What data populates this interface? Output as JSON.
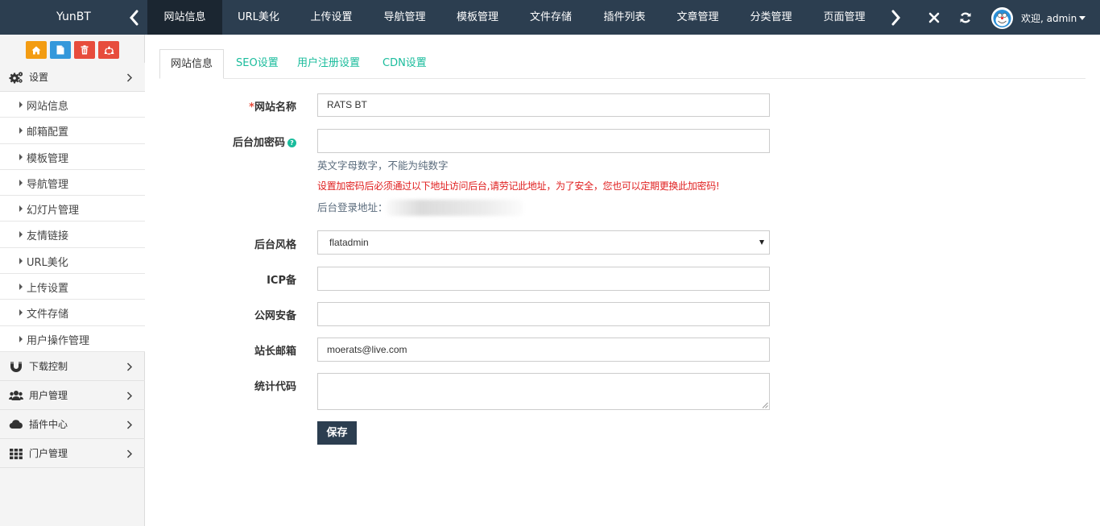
{
  "app": {
    "brand": "YunBT"
  },
  "topnav": {
    "items": [
      {
        "label": "网站信息",
        "active": true
      },
      {
        "label": "URL美化"
      },
      {
        "label": "上传设置"
      },
      {
        "label": "导航管理"
      },
      {
        "label": "模板管理"
      },
      {
        "label": "文件存储"
      },
      {
        "label": "插件列表"
      },
      {
        "label": "文章管理"
      },
      {
        "label": "分类管理"
      },
      {
        "label": "页面管理"
      }
    ],
    "icons": [
      "chevron-left-icon",
      "chevron-right-icon",
      "close-icon",
      "refresh-icon",
      "avatar"
    ]
  },
  "user": {
    "welcome": "欢迎, admin"
  },
  "sidebar": {
    "quick_buttons": [
      {
        "icon": "home-icon",
        "color": "#f39c12"
      },
      {
        "icon": "file-icon",
        "color": "#3498db"
      },
      {
        "icon": "trash-icon",
        "color": "#e74c3c"
      },
      {
        "icon": "recycle-icon",
        "color": "#e74c3c"
      }
    ],
    "sections": [
      {
        "label": "设置",
        "icon": "gears-icon",
        "expanded": true
      },
      {
        "label": "下载控制",
        "icon": "magnet-icon"
      },
      {
        "label": "用户管理",
        "icon": "users-icon"
      },
      {
        "label": "插件中心",
        "icon": "cloud-icon"
      },
      {
        "label": "门户管理",
        "icon": "grid-icon"
      }
    ],
    "settings_items": [
      "网站信息",
      "邮箱配置",
      "模板管理",
      "导航管理",
      "幻灯片管理",
      "友情链接",
      "URL美化",
      "上传设置",
      "文件存储",
      "用户操作管理"
    ]
  },
  "tabs": [
    {
      "label": "网站信息",
      "active": true
    },
    {
      "label": "SEO设置"
    },
    {
      "label": "用户注册设置"
    },
    {
      "label": "CDN设置"
    }
  ],
  "form": {
    "site_name": {
      "required_mark": "*",
      "label": "网站名称",
      "value": "RATS BT"
    },
    "admin_password": {
      "label": "后台加密码",
      "help_icon": "?",
      "value": "",
      "hint": "英文字母数字，不能为纯数字",
      "warning": "设置加密码后必须通过以下地址访问后台,请劳记此地址，为了安全，您也可以定期更换此加密码!",
      "login_url_label": "后台登录地址："
    },
    "admin_theme": {
      "label": "后台风格",
      "value": "flatadmin"
    },
    "icp": {
      "label": "ICP备",
      "value": ""
    },
    "police": {
      "label": "公网安备",
      "value": ""
    },
    "email": {
      "label": "站长邮箱",
      "value": "moerats@live.com"
    },
    "stats_code": {
      "label": "统计代码",
      "value": ""
    },
    "save_label": "保存"
  },
  "colors": {
    "topbar": "#2c3e50",
    "accent": "#1abc9c",
    "warning_text": "#e02020",
    "hint_text": "#5a6b7c",
    "sidebar_bg": "#f4f4f4"
  }
}
